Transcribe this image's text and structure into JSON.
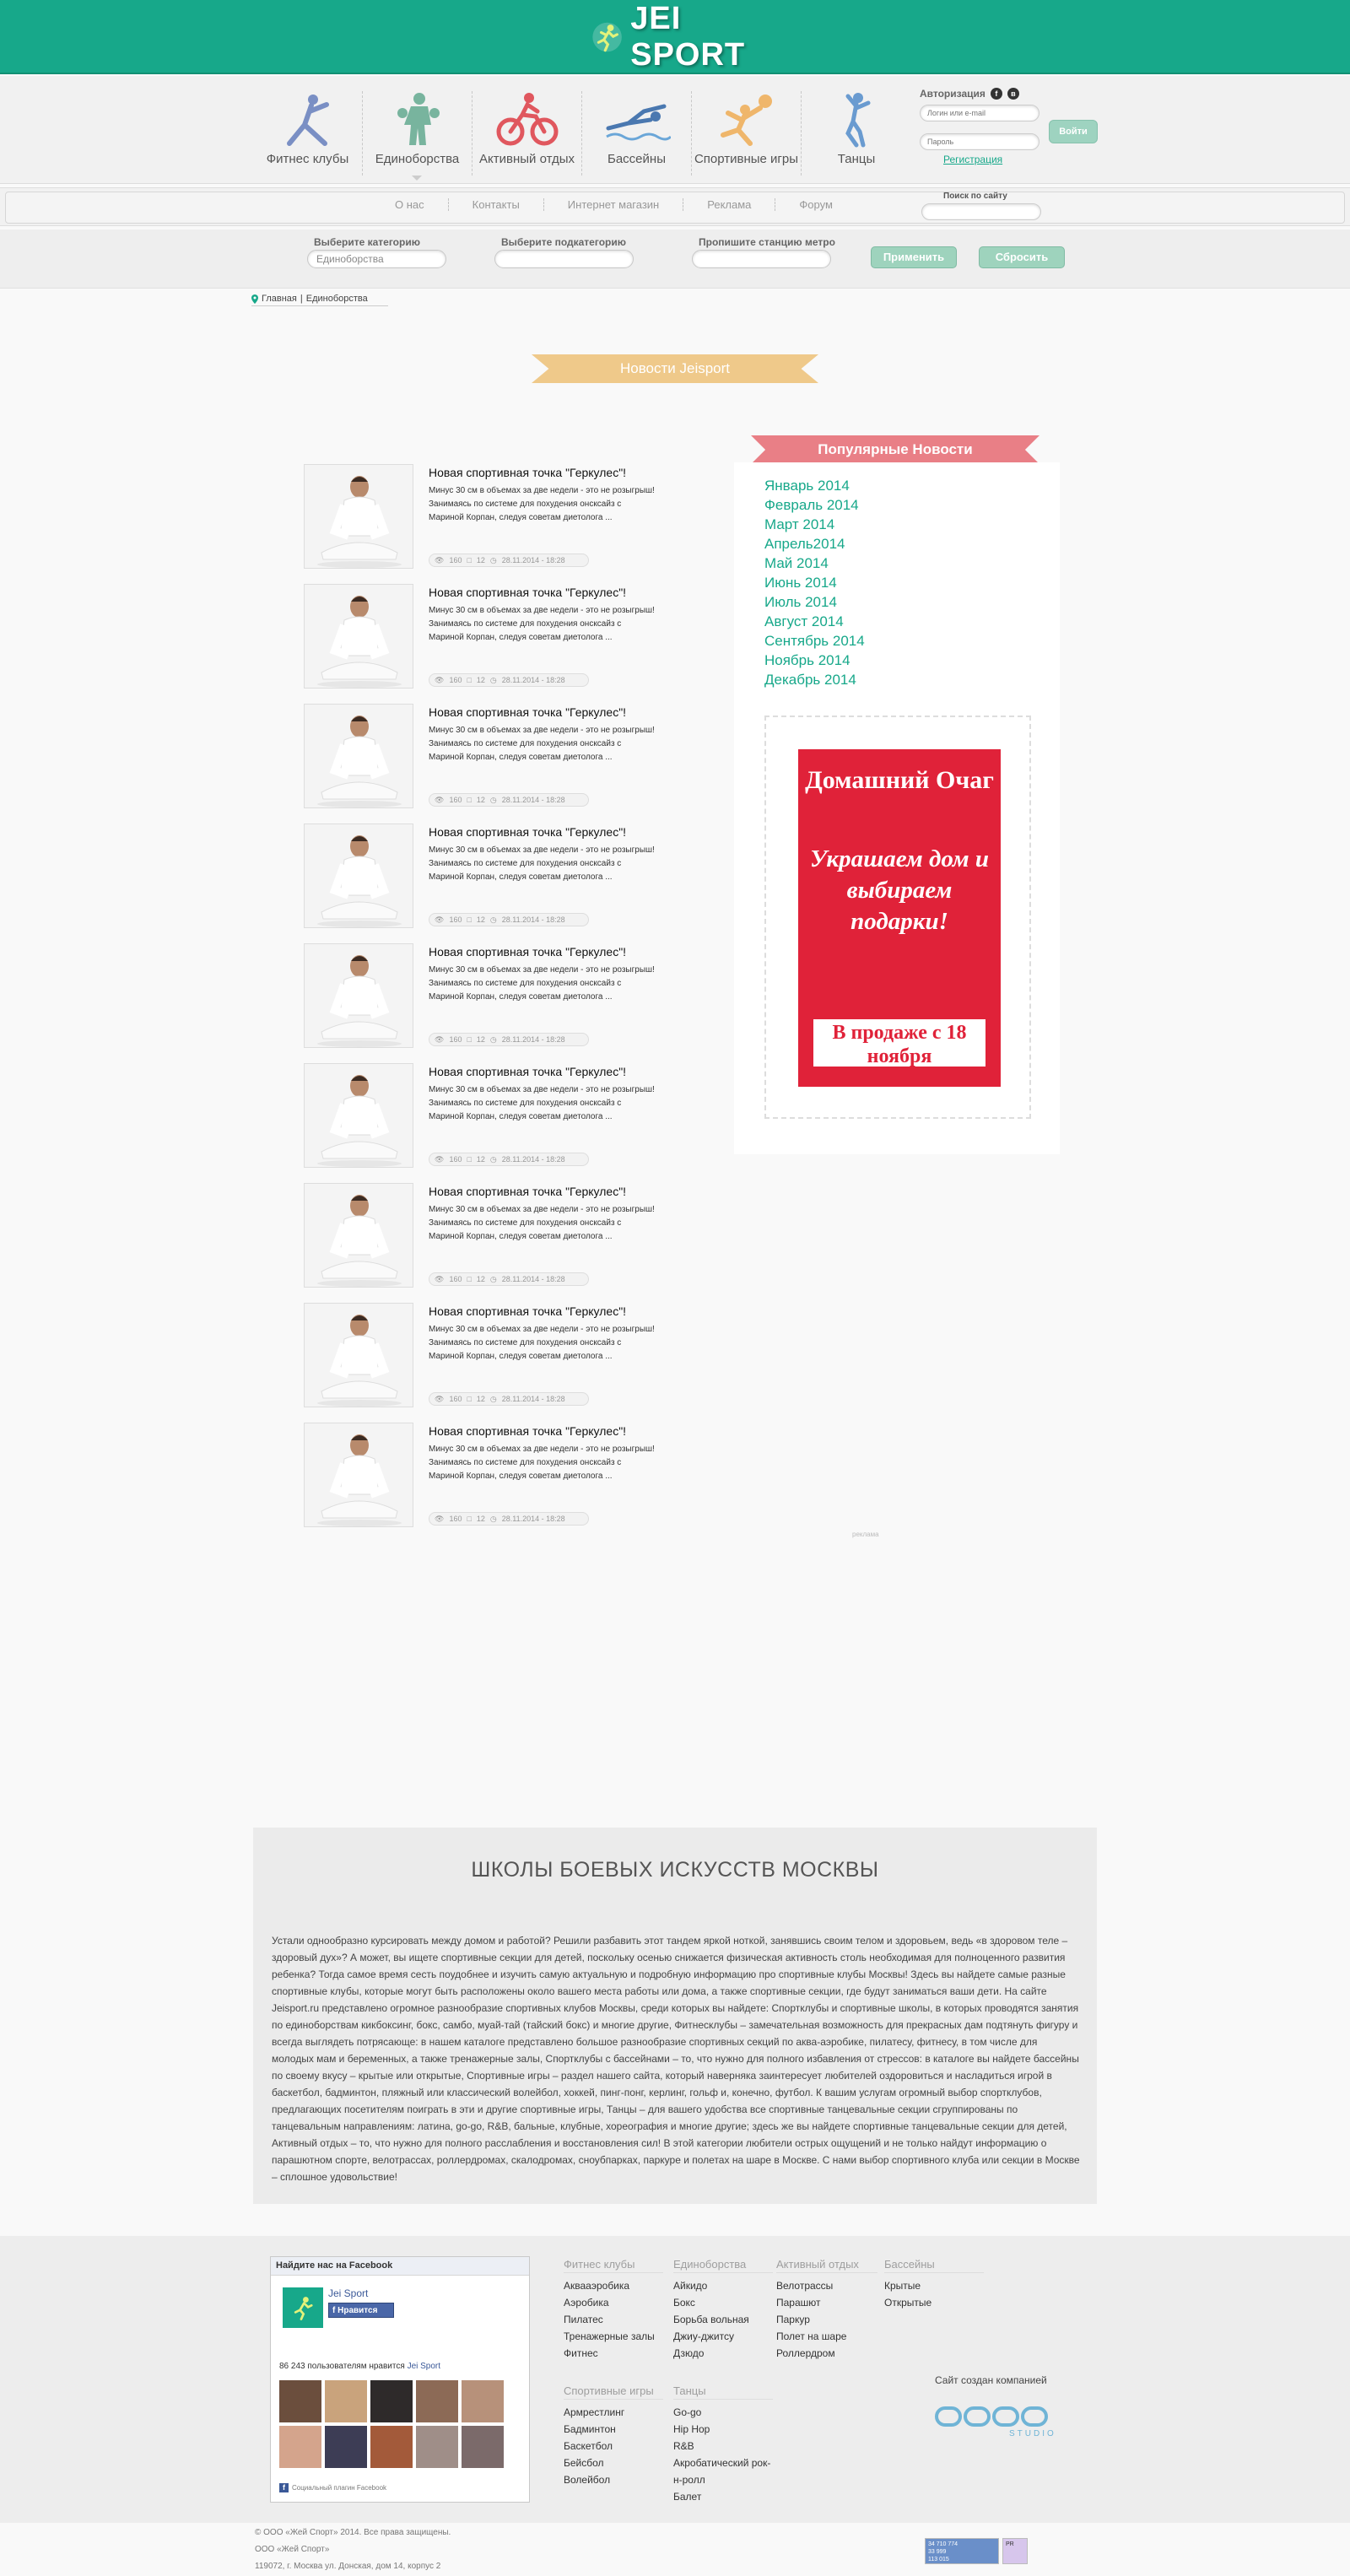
{
  "header": {
    "brand": "JEI SPORT"
  },
  "categories": [
    {
      "label": "Фитнес клубы",
      "icon": "yoga-icon",
      "color": "#7a8fc4"
    },
    {
      "label": "Единоборства",
      "icon": "boxer-icon",
      "color": "#78b49e"
    },
    {
      "label": "Активный отдых",
      "icon": "bicycle-icon",
      "color": "#e0575e"
    },
    {
      "label": "Бассейны",
      "icon": "swimmer-icon",
      "color": "#4a78b0"
    },
    {
      "label": "Спортивные игры",
      "icon": "volleyball-icon",
      "color": "#efb66b"
    },
    {
      "label": "Танцы",
      "icon": "dancer-icon",
      "color": "#6a9bd0"
    }
  ],
  "auth": {
    "title": "Авторизация",
    "login_placeholder": "Логин или e-mail",
    "password_placeholder": "Пароль",
    "login_button": "Войти",
    "register_link": "Регистрация"
  },
  "menu": [
    "О нас",
    "Контакты",
    "Интернет магазин",
    "Реклама",
    "Форум"
  ],
  "search": {
    "label": "Поиск по сайту",
    "placeholder": ""
  },
  "filters": {
    "category_label": "Выберите категорию",
    "category_value": "Единоборства",
    "subcategory_label": "Выберите подкатегорию",
    "subcategory_value": "",
    "metro_label": "Пропишите станцию метро",
    "metro_value": "",
    "apply_button": "Применить",
    "reset_button": "Сбросить"
  },
  "breadcrumb": {
    "home": "Главная",
    "separator": " | ",
    "current": "Единоборства"
  },
  "news_ribbon": "Новости Jeisport",
  "popular_ribbon": "Популярные Новости",
  "news": [
    {
      "title": "Новая спортивная точка \"Геркулес\"!",
      "text": "Минус 30 см в объемах за две недели - это не розыгрыш! Занимаясь по системе для похудения онсксайз с Мариной Корпан, следуя советам диетолога ...",
      "views": "160",
      "comments": "12",
      "date": "28.11.2014 - 18:28"
    },
    {
      "title": "Новая спортивная точка \"Геркулес\"!",
      "text": "Минус 30 см в объемах за две недели - это не розыгрыш! Занимаясь по системе для похудения онсксайз с Мариной Корпан, следуя советам диетолога ...",
      "views": "160",
      "comments": "12",
      "date": "28.11.2014 - 18:28"
    },
    {
      "title": "Новая спортивная точка \"Геркулес\"!",
      "text": "Минус 30 см в объемах за две недели - это не розыгрыш! Занимаясь по системе для похудения онсксайз с Мариной Корпан, следуя советам диетолога ...",
      "views": "160",
      "comments": "12",
      "date": "28.11.2014 - 18:28"
    },
    {
      "title": "Новая спортивная точка \"Геркулес\"!",
      "text": "Минус 30 см в объемах за две недели - это не розыгрыш! Занимаясь по системе для похудения онсксайз с Мариной Корпан, следуя советам диетолога ...",
      "views": "160",
      "comments": "12",
      "date": "28.11.2014 - 18:28"
    },
    {
      "title": "Новая спортивная точка \"Геркулес\"!",
      "text": "Минус 30 см в объемах за две недели - это не розыгрыш! Занимаясь по системе для похудения онсксайз с Мариной Корпан, следуя советам диетолога ...",
      "views": "160",
      "comments": "12",
      "date": "28.11.2014 - 18:28"
    },
    {
      "title": "Новая спортивная точка \"Геркулес\"!",
      "text": "Минус 30 см в объемах за две недели - это не розыгрыш! Занимаясь по системе для похудения онсксайз с Мариной Корпан, следуя советам диетолога ...",
      "views": "160",
      "comments": "12",
      "date": "28.11.2014 - 18:28"
    },
    {
      "title": "Новая спортивная точка \"Геркулес\"!",
      "text": "Минус 30 см в объемах за две недели - это не розыгрыш! Занимаясь по системе для похудения онсксайз с Мариной Корпан, следуя советам диетолога ...",
      "views": "160",
      "comments": "12",
      "date": "28.11.2014 - 18:28"
    },
    {
      "title": "Новая спортивная точка \"Геркулес\"!",
      "text": "Минус 30 см в объемах за две недели - это не розыгрыш! Занимаясь по системе для похудения онсксайз с Мариной Корпан, следуя советам диетолога ...",
      "views": "160",
      "comments": "12",
      "date": "28.11.2014 - 18:28"
    },
    {
      "title": "Новая спортивная точка \"Геркулес\"!",
      "text": "Минус 30 см в объемах за две недели - это не розыгрыш! Занимаясь по системе для похудения онсксайз с Мариной Корпан, следуя советам диетолога ...",
      "views": "160",
      "comments": "12",
      "date": "28.11.2014 - 18:28"
    }
  ],
  "months": [
    "Январь 2014",
    "Февраль 2014",
    "Март 2014",
    "Апрель2014",
    "Май 2014",
    "Июнь 2014",
    "Июль 2014",
    "Август 2014",
    "Сентябрь 2014",
    "Ноябрь 2014",
    "Декабрь 2014"
  ],
  "ad": {
    "brand": "Домашний Очаг",
    "slogan": "Украшаем дом и выбираем подарки!",
    "date": "В продаже с 18 ноября",
    "caption": "реклама"
  },
  "seo": {
    "title": "ШКОЛЫ БОЕВЫХ ИСКУССТВ МОСКВЫ",
    "text": "Устали однообразно курсировать между домом и работой? Решили разбавить этот тандем яркой ноткой, занявшись своим телом и здоровьем, ведь «в здоровом теле – здоровый дух»? А может, вы ищете спортивные секции для детей, поскольку осенью снижается физическая активность столь необходимая для полноценного развития ребенка? Тогда самое время сесть поудобнее и изучить самую актуальную и подробную информацию про спортивные клубы Москвы! Здесь вы найдете самые разные спортивные клубы, которые могут быть расположены около вашего места работы или дома, а также спортивные секции, где будут заниматься ваши дети. На сайте Jeisport.ru представлено огромное разнообразие спортивных клубов Москвы, среди которых вы найдете: Спортклубы и спортивные школы, в которых проводятся занятия по единоборствам кикбоксинг, бокс, самбо, муай-тай (тайский бокс) и многие другие, Фитнесклубы – замечательная возможность для прекрасных дам подтянуть фигуру и всегда выглядеть потрясающе: в нашем каталоге представлено большое разнообразие спортивных секций по аква-аэробике, пилатесу, фитнесу, в том числе для молодых мам и беременных, а также тренажерные залы, Спортклубы с бассейнами – то, что нужно для полного избавления от стрессов: в каталоге вы найдете бассейны по своему вкусу – крытые или открытые, Спортивные игры – раздел нашего сайта, который наверняка заинтересует любителей оздоровиться и насладиться игрой в баскетбол, бадминтон, пляжный или классический волейбол, хоккей, пинг-понг, керлинг, гольф и, конечно, футбол. К вашим услугам огромный выбор спортклубов, предлагающих посетителям поиграть в эти и другие спортивные игры, Танцы – для вашего удобства все спортивные танцевальные секции сгруппированы по танцевальным направлениям: латина, go-go, R&B, бальные, клубные, хореография и многие другие; здесь же вы найдете спортивные танцевальные секции для детей, Активный отдых – то, что нужно для полного расслабления и восстановления сил! В этой категории любители острых ощущений и не только найдут информацию о парашютном спорте, велотрассах, роллердромах, скалодромах, сноубпарках, паркуре и полетах на шаре в Москве. С нами выбор спортивного клуба или секции в Москве – сплошное удовольствие!"
  },
  "facebook": {
    "header": "Найдите нас на Facebook",
    "page_name": "Jei Sport",
    "like_button": "Нравится",
    "count_text": "86 243 пользователям нравится",
    "count_link": "Jei Sport",
    "plugin_text": "Социальный плагин Facebook"
  },
  "footer_cols": [
    {
      "title": "Фитнес клубы",
      "items": [
        "Аквааэробика",
        "Аэробика",
        "Пилатес",
        "Тренажерные залы",
        "Фитнес"
      ]
    },
    {
      "title": "Единоборства",
      "items": [
        "Айкидо",
        "Бокс",
        "Борьба вольная",
        "Джиу-джитсу",
        "Дзюдо"
      ]
    },
    {
      "title": "Активный отдых",
      "items": [
        "Велотрассы",
        "Парашют",
        "Паркур",
        "Полет на шаре",
        "Роллердром"
      ]
    },
    {
      "title": "Бассейны",
      "items": [
        "Крытые",
        "Открытые"
      ]
    },
    {
      "title": "Спортивные игры",
      "items": [
        "Армрестлинг",
        "Бадминтон",
        "Баскетбол",
        "Бейсбол",
        "Волейбол"
      ]
    },
    {
      "title": "Танцы",
      "items": [
        "Go-go",
        "Hip Hop",
        "R&B",
        "Акробатический рок-н-ролл",
        "Балет"
      ]
    }
  ],
  "made_by": "Сайт создан компанией",
  "studio_name": "STUDIO",
  "copyright": [
    "© ООО «Жей Спорт» 2014. Все права защищены.",
    "ООО «Жей Спорт»",
    "119072, г. Москва ул. Донская, дом 14, корпус 2"
  ],
  "counters": [
    {
      "label": "LiveInternet",
      "lines": [
        "34 710 774",
        "33 999",
        "113 015"
      ]
    },
    {
      "label": "",
      "lines": [
        "PR"
      ]
    }
  ],
  "colors": {
    "brand": "#17a88a",
    "news_ribbon": "#efc98a",
    "popular_ribbon": "#e97f86",
    "ad_red": "#e02239"
  }
}
